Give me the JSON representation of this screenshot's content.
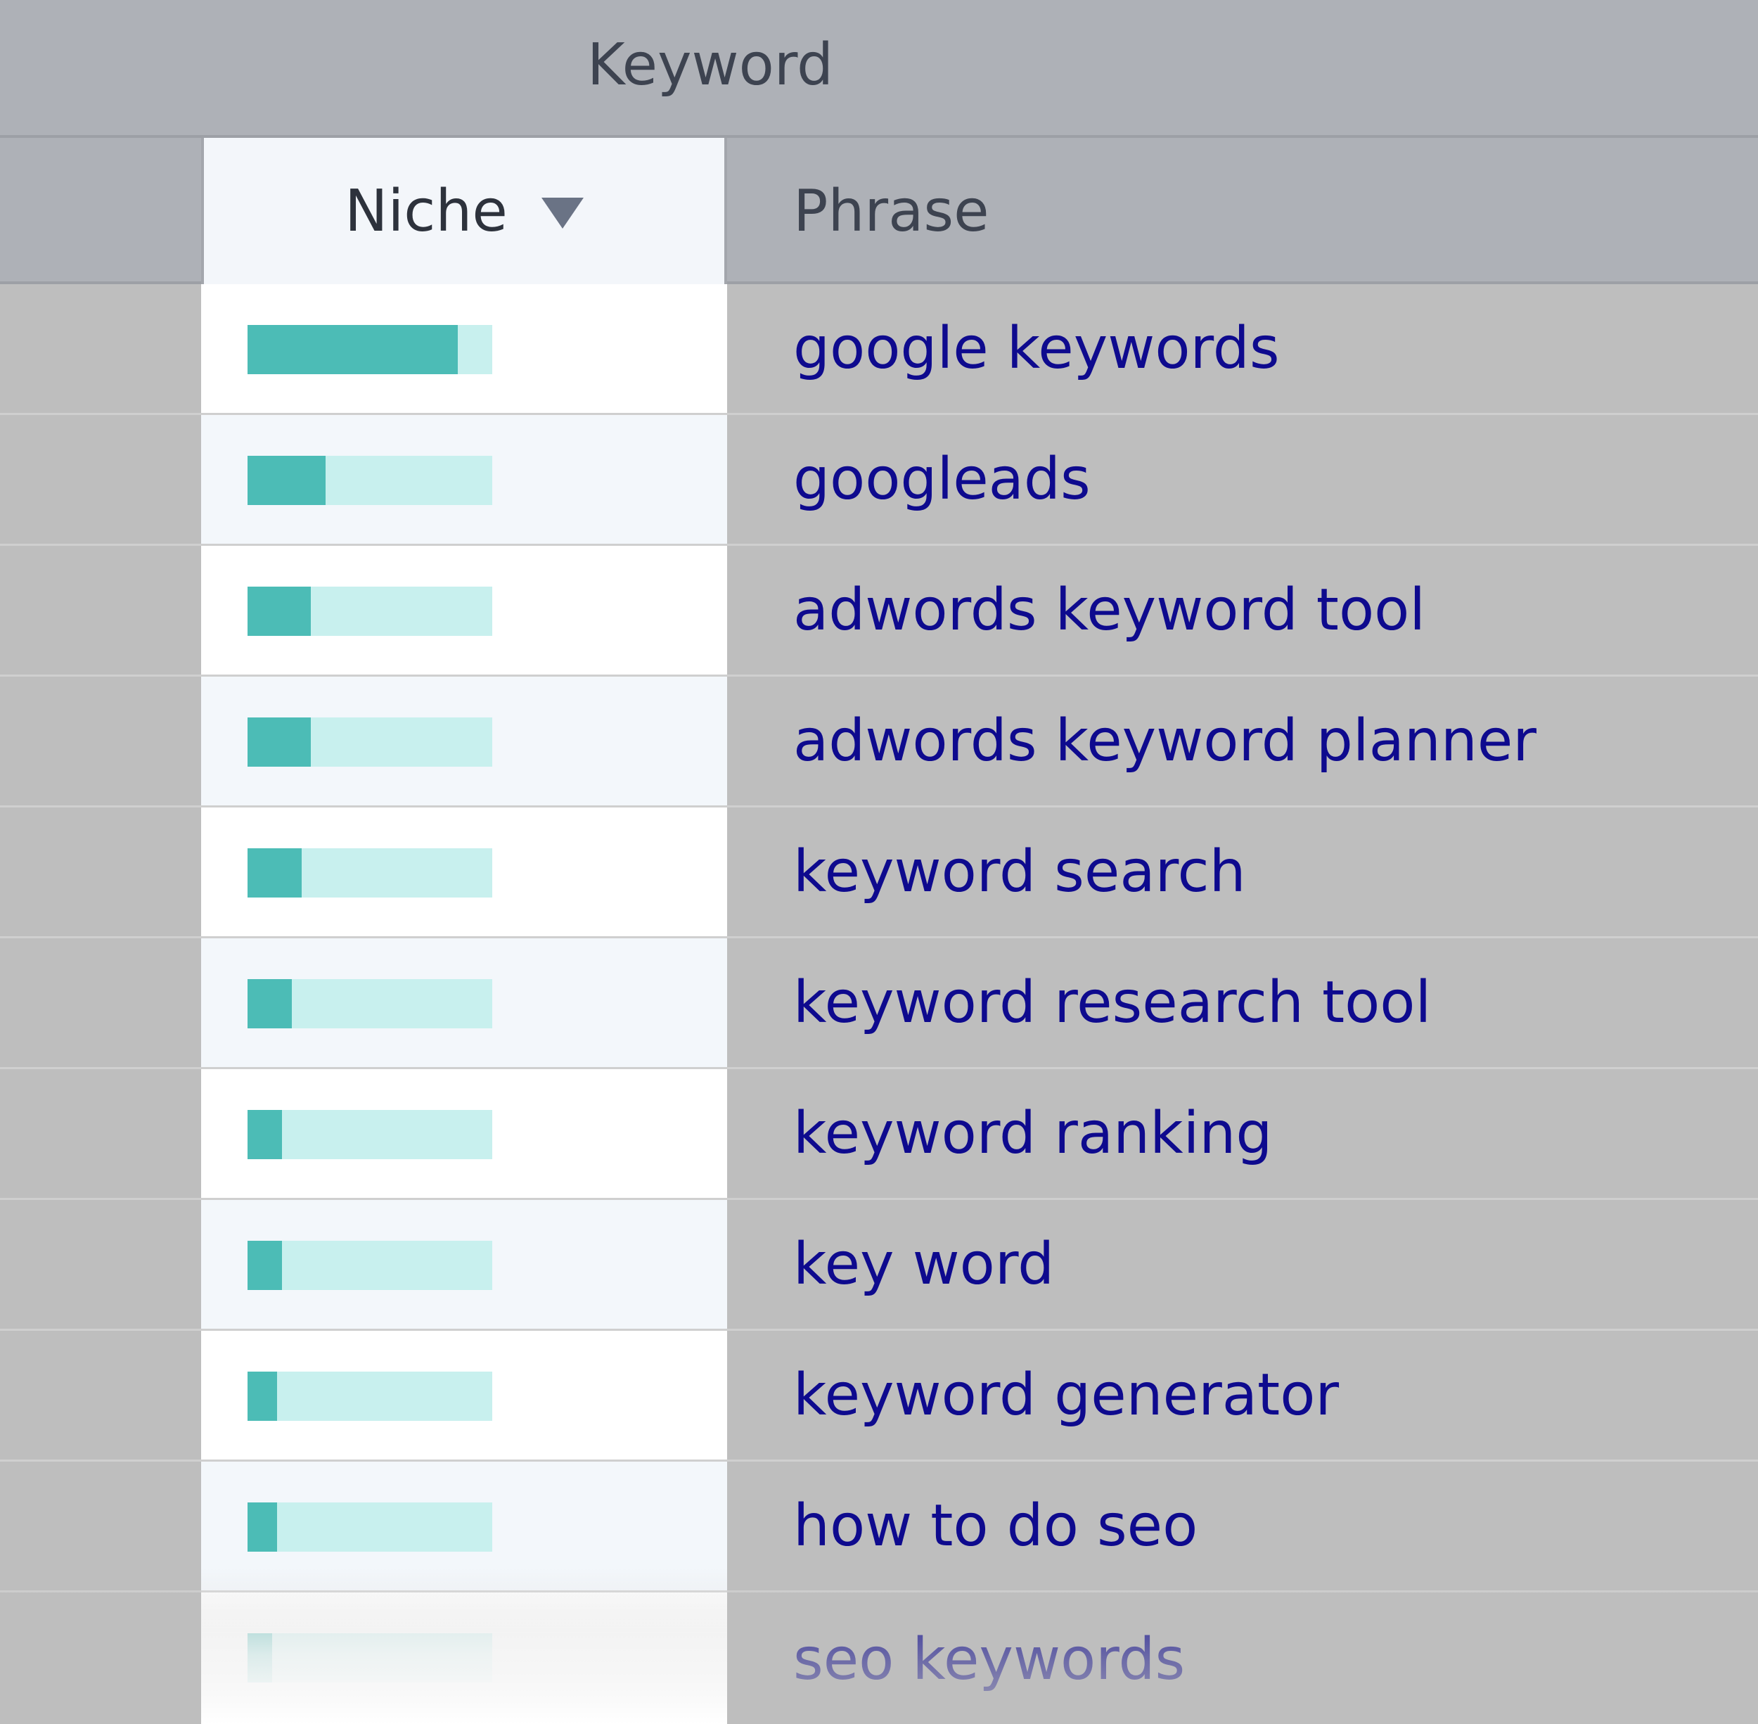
{
  "header": {
    "group_title": "Keyword",
    "niche_label": "Niche",
    "sort_direction": "descending",
    "phrase_label": "Phrase"
  },
  "colors": {
    "bar_fill": "#4cbcb6",
    "bar_track": "#c8f0ee",
    "link": "#0e0a8e"
  },
  "rows": [
    {
      "phrase": "google keywords",
      "niche": 0.86
    },
    {
      "phrase": "googleads",
      "niche": 0.32
    },
    {
      "phrase": "adwords keyword tool",
      "niche": 0.26
    },
    {
      "phrase": "adwords keyword planner",
      "niche": 0.26
    },
    {
      "phrase": "keyword search",
      "niche": 0.22
    },
    {
      "phrase": "keyword research tool",
      "niche": 0.18
    },
    {
      "phrase": "keyword ranking",
      "niche": 0.14
    },
    {
      "phrase": "key word",
      "niche": 0.14
    },
    {
      "phrase": "keyword generator",
      "niche": 0.12
    },
    {
      "phrase": "how to do seo",
      "niche": 0.12
    },
    {
      "phrase": "seo keywords",
      "niche": 0.1
    }
  ]
}
